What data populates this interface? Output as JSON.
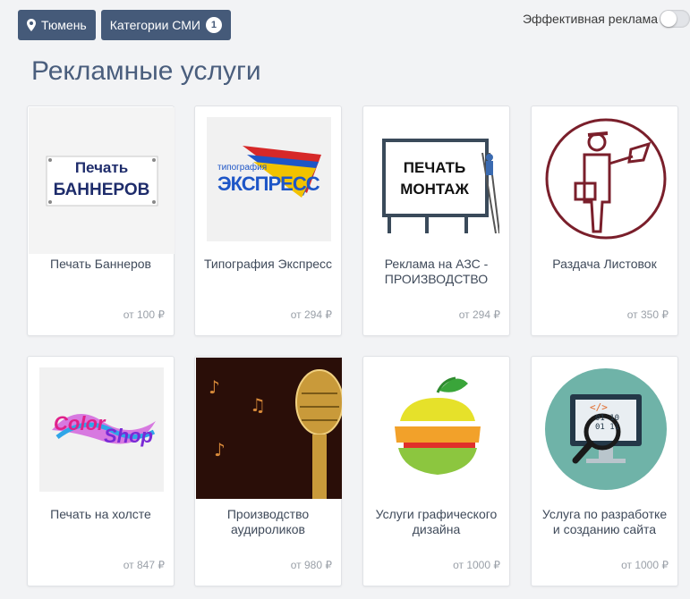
{
  "topbar": {
    "city_label": "Тюмень",
    "categories_label": "Категории СМИ",
    "categories_count": "1"
  },
  "effective_ads": {
    "label": "Эффективная реклама",
    "enabled": false
  },
  "page_title": "Рекламные услуги",
  "cards": [
    {
      "title": "Печать Баннеров",
      "price": "от 100 ₽",
      "image": {
        "line1": "Печать",
        "line2": "БАННЕРОВ"
      }
    },
    {
      "title": "Типография Экспресс",
      "price": "от 294 ₽",
      "image": {
        "line1": "типография",
        "line2": "ЭКСПРЕСС"
      }
    },
    {
      "title": "Реклама на АЗС - ПРОИЗВОДСТВО",
      "price": "от 294 ₽",
      "image": {
        "line1": "ПЕЧАТЬ",
        "line2": "МОНТАЖ"
      }
    },
    {
      "title": "Раздача Листовок",
      "price": "от 350 ₽"
    },
    {
      "title": "Печать на холсте",
      "price": "от 847 ₽",
      "image": {
        "line1": "Color",
        "line2": "Shop"
      }
    },
    {
      "title": "Производство аудироликов",
      "price": "от 980 ₽"
    },
    {
      "title": "Услуги графического дизайна",
      "price": "от 1000 ₽"
    },
    {
      "title": "Услуга по разработке и созданию сайта",
      "price": "от 1000 ₽",
      "image": {
        "line1": "</>",
        "line2": "01 10 01 11"
      }
    }
  ],
  "colors": {
    "accent": "#455a79",
    "title": "#4a5e7d",
    "background": "#f2f3f5"
  }
}
